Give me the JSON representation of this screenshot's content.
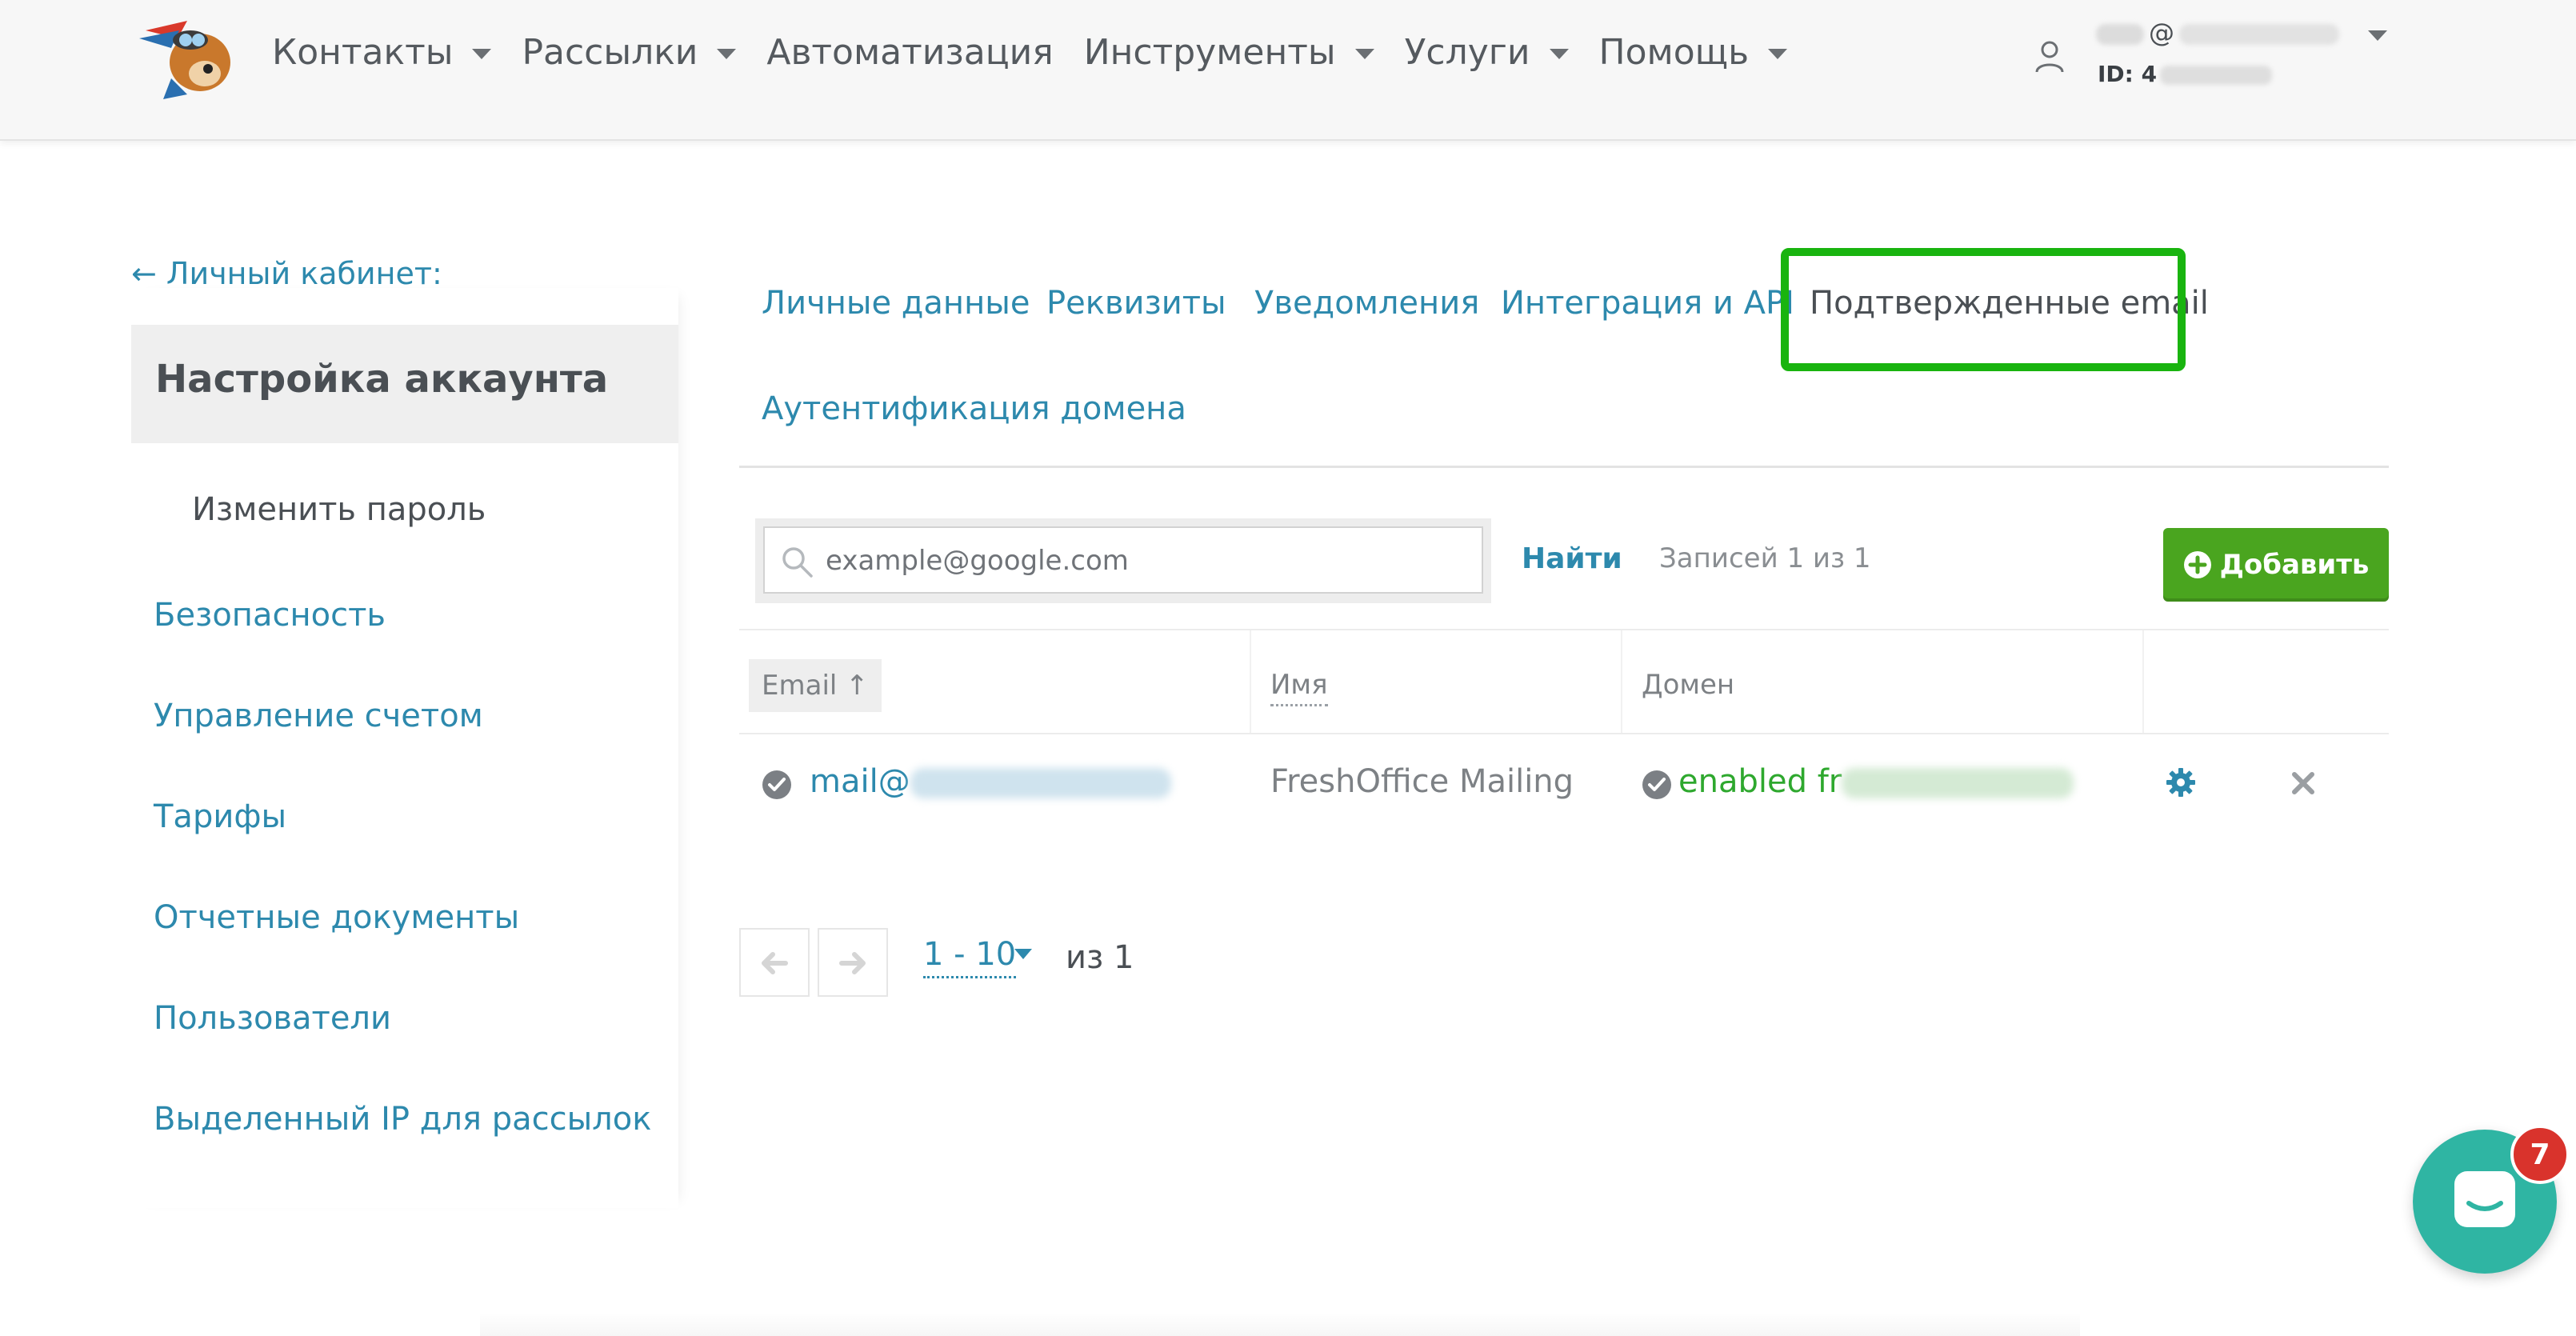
{
  "topnav": {
    "items": [
      {
        "label": "Контакты",
        "dropdown": true
      },
      {
        "label": "Рассылки",
        "dropdown": true
      },
      {
        "label": "Автоматизация",
        "dropdown": false
      },
      {
        "label": "Инструменты",
        "dropdown": true
      },
      {
        "label": "Услуги",
        "dropdown": true
      },
      {
        "label": "Помощь",
        "dropdown": true
      }
    ],
    "user": {
      "email_symbol": "@",
      "id_label": "ID: 4"
    }
  },
  "sidebar": {
    "back_link": "← Личный кабинет:",
    "title": "Настройка аккаунта",
    "sub_item": "Изменить пароль",
    "links": [
      "Безопасность",
      "Управление счетом",
      "Тарифы",
      "Отчетные документы",
      "Пользователи",
      "Выделенный IP для рассылок"
    ]
  },
  "tabs": {
    "items": [
      "Личные данные",
      "Реквизиты",
      "Уведомления",
      "Интеграция и API",
      "Подтвержденные email",
      "Аутентификация домена"
    ],
    "active": "Подтвержденные email"
  },
  "toolbar": {
    "search_placeholder": "example@google.com",
    "find_label": "Найти",
    "records_label": "Записей 1 из 1",
    "add_label": "Добавить"
  },
  "table": {
    "headers": {
      "email": "Email ↑",
      "name": "Имя",
      "domain": "Домен"
    },
    "rows": [
      {
        "email": "mail@",
        "name": "FreshOffice Mailing",
        "domain": "enabled fr"
      }
    ]
  },
  "pagination": {
    "range": "1 - 10",
    "total": "из 1"
  },
  "chat": {
    "badge": "7"
  },
  "colors": {
    "link": "#2d89ad",
    "accent_green": "#4aa51f",
    "highlight": "#19b40f",
    "chat": "#2fb5a3",
    "badge": "#d9332c"
  }
}
